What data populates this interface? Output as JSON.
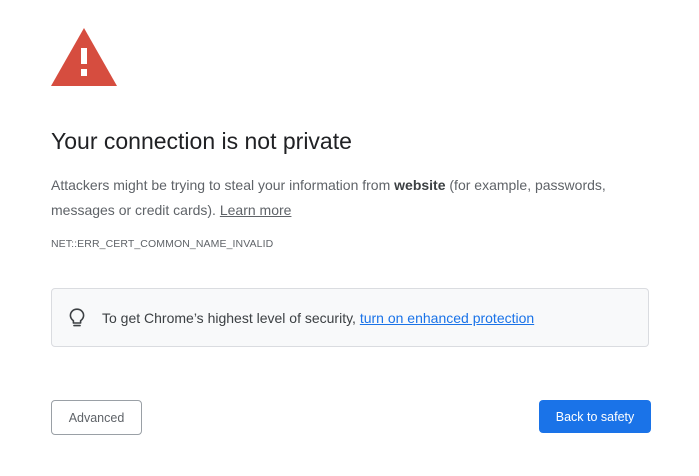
{
  "page": {
    "title": "Your connection is not private",
    "description_before": "Attackers might be trying to steal your information from ",
    "site_name": "website",
    "description_after": " (for example, passwords, messages or credit cards). ",
    "learn_more_label": "Learn more",
    "error_code": "NET::ERR_CERT_COMMON_NAME_INVALID"
  },
  "enhanced_protection": {
    "text": "To get Chrome’s highest level of security, ",
    "link_label": "turn on enhanced protection"
  },
  "buttons": {
    "advanced_label": "Advanced",
    "back_to_safety_label": "Back to safety"
  },
  "icons": {
    "warning": "warning-triangle-icon",
    "tip": "lightbulb-icon"
  },
  "colors": {
    "warning_red": "#D64D3F",
    "primary_blue": "#1A73E8",
    "link_blue": "#1A73E8",
    "box_background": "#F8F9FA"
  }
}
